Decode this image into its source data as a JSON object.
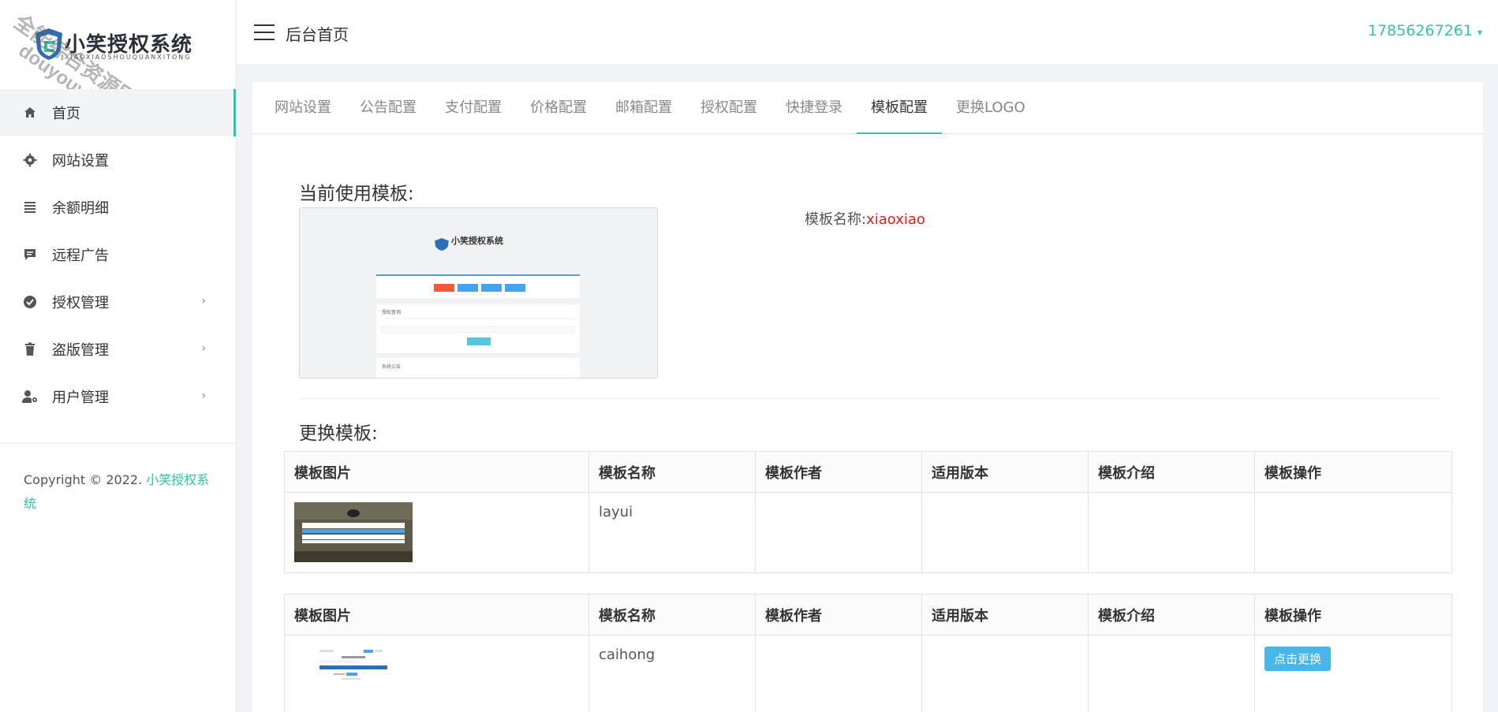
{
  "brand": {
    "name": "小笑授权系统",
    "subtitle": "XIAOXIAOSHOUQUANXITONG",
    "watermark_line1": "全能综合资源网",
    "watermark_line2": "douyouvip.com"
  },
  "sidebar": {
    "items": [
      {
        "label": "首页",
        "icon": "home-icon",
        "active": true,
        "has_children": false
      },
      {
        "label": "网站设置",
        "icon": "gear-icon",
        "active": false,
        "has_children": false
      },
      {
        "label": "余额明细",
        "icon": "list-icon",
        "active": false,
        "has_children": false
      },
      {
        "label": "远程广告",
        "icon": "message-icon",
        "active": false,
        "has_children": false
      },
      {
        "label": "授权管理",
        "icon": "badge-check-icon",
        "active": false,
        "has_children": true
      },
      {
        "label": "盗版管理",
        "icon": "trash-icon",
        "active": false,
        "has_children": true
      },
      {
        "label": "用户管理",
        "icon": "user-gear-icon",
        "active": false,
        "has_children": true
      }
    ],
    "chevron": "›",
    "copyright_prefix": "Copyright © 2022. ",
    "copyright_brand": "小笑授权系统"
  },
  "header": {
    "title": "后台首页",
    "user": "17856267261",
    "caret": "▾"
  },
  "tabs": [
    {
      "label": "网站设置",
      "active": false
    },
    {
      "label": "公告配置",
      "active": false
    },
    {
      "label": "支付配置",
      "active": false
    },
    {
      "label": "价格配置",
      "active": false
    },
    {
      "label": "邮箱配置",
      "active": false
    },
    {
      "label": "授权配置",
      "active": false
    },
    {
      "label": "快捷登录",
      "active": false
    },
    {
      "label": "模板配置",
      "active": true
    },
    {
      "label": "更换LOGO",
      "active": false
    }
  ],
  "current": {
    "heading": "当前使用模板:",
    "name_label": "模板名称:",
    "name_value": "xiaoxiao",
    "preview_logo": "小笑授权系统",
    "preview_section1": "授权查询",
    "preview_section2": "系统公告"
  },
  "change": {
    "heading": "更换模板:"
  },
  "table_headers": [
    "模板图片",
    "模板名称",
    "模板作者",
    "适用版本",
    "模板介绍",
    "模板操作"
  ],
  "templates": [
    {
      "name": "layui",
      "author": "",
      "version": "",
      "intro": "",
      "action": ""
    },
    {
      "name": "caihong",
      "author": "",
      "version": "",
      "intro": "",
      "action": "点击更换"
    }
  ],
  "colors": {
    "accent": "#33c3a8",
    "red": "#e41c1c",
    "button": "#47b6ea"
  }
}
